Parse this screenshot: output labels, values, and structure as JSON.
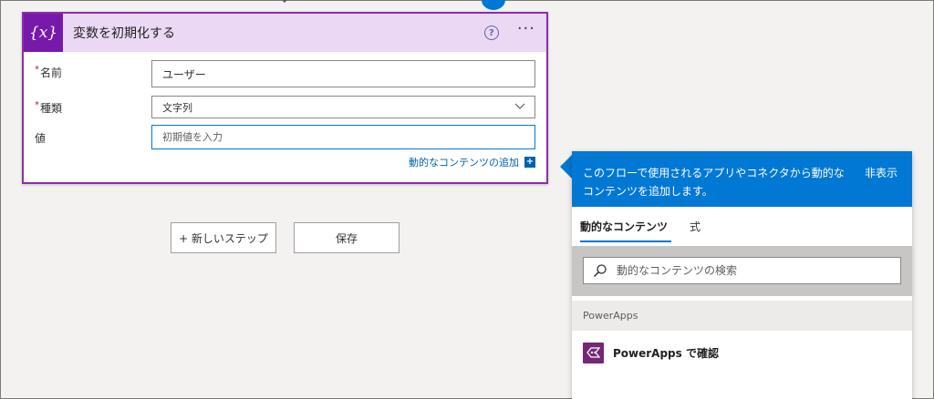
{
  "action_card": {
    "title": "変数を初期化する",
    "icon_glyph": "{x}",
    "help_glyph": "?",
    "more_glyph": "···",
    "fields": {
      "name": {
        "label": "名前",
        "required_mark": "*",
        "value": "ユーザー"
      },
      "type": {
        "label": "種類",
        "required_mark": "*",
        "value": "文字列"
      },
      "value": {
        "label": "値",
        "placeholder": "初期値を入力"
      }
    },
    "add_dynamic_link": "動的なコンテンツの追加",
    "add_dynamic_glyph": "+"
  },
  "buttons": {
    "new_step": "+ 新しいステップ",
    "save": "保存"
  },
  "dynamic_panel": {
    "description": "このフローで使用されるアプリやコネクタから動的なコンテンツを追加します。",
    "hide_label": "非表示",
    "tabs": [
      {
        "label": "動的なコンテンツ",
        "active": true
      },
      {
        "label": "式",
        "active": false
      }
    ],
    "search": {
      "placeholder": "動的なコンテンツの検索"
    },
    "sections": [
      {
        "header": "PowerApps",
        "items": [
          {
            "label": "PowerApps で確認",
            "icon": "powerapps-icon"
          }
        ]
      }
    ]
  },
  "colors": {
    "card_border": "#8a2ea8",
    "card_header_bg": "#ead8f5",
    "variable_icon_bg": "#7719aa",
    "panel_header_bg": "#0078d4",
    "link": "#0062ad",
    "powerapps_icon_bg": "#742774"
  },
  "icons": [
    "connector-arrow-icon",
    "variable-icon",
    "help-icon",
    "more-icon",
    "chevron-down-icon",
    "plus-icon",
    "search-icon",
    "powerapps-icon"
  ]
}
